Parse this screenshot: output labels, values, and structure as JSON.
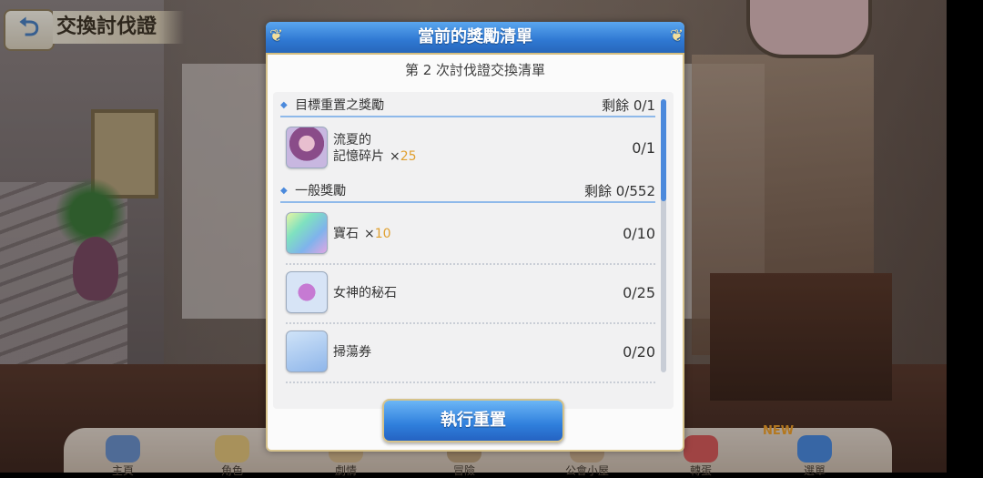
{
  "screen": {
    "title": "交換討伐證"
  },
  "dialog": {
    "title": "當前的獎勵清單",
    "subtitle": "第 2 次討伐證交換清單",
    "sections": [
      {
        "label": "目標重置之獎勵",
        "remaining": "剩餘 0/1"
      },
      {
        "label": "一般獎勵",
        "remaining": "剩餘 0/552"
      }
    ],
    "items": [
      {
        "name_line1": "流夏的",
        "name_line2": "記憶碎片",
        "times": "×",
        "qty": "25",
        "count": "0/1",
        "icon": "character-portrait-icon"
      },
      {
        "name": "寶石",
        "times": "×",
        "qty": "10",
        "count": "0/10",
        "icon": "jewel-icon"
      },
      {
        "name": "女神的秘石",
        "count": "0/25",
        "icon": "goddess-stone-icon"
      },
      {
        "name": "掃蕩券",
        "count": "0/20",
        "icon": "sweep-ticket-icon"
      }
    ],
    "execute_button": "執行重置",
    "colors": {
      "header_blue": "#2f78d2",
      "accent_gold": "#e0a030",
      "border_gold": "#d8c48d"
    }
  },
  "bottom_nav": {
    "items": [
      {
        "label": "主頁"
      },
      {
        "label": "角色"
      },
      {
        "label": "劇情"
      },
      {
        "label": "冒險"
      },
      {
        "label": "公會小屋"
      },
      {
        "label": "轉蛋"
      },
      {
        "label": "選單"
      }
    ],
    "badge": "NEW"
  }
}
